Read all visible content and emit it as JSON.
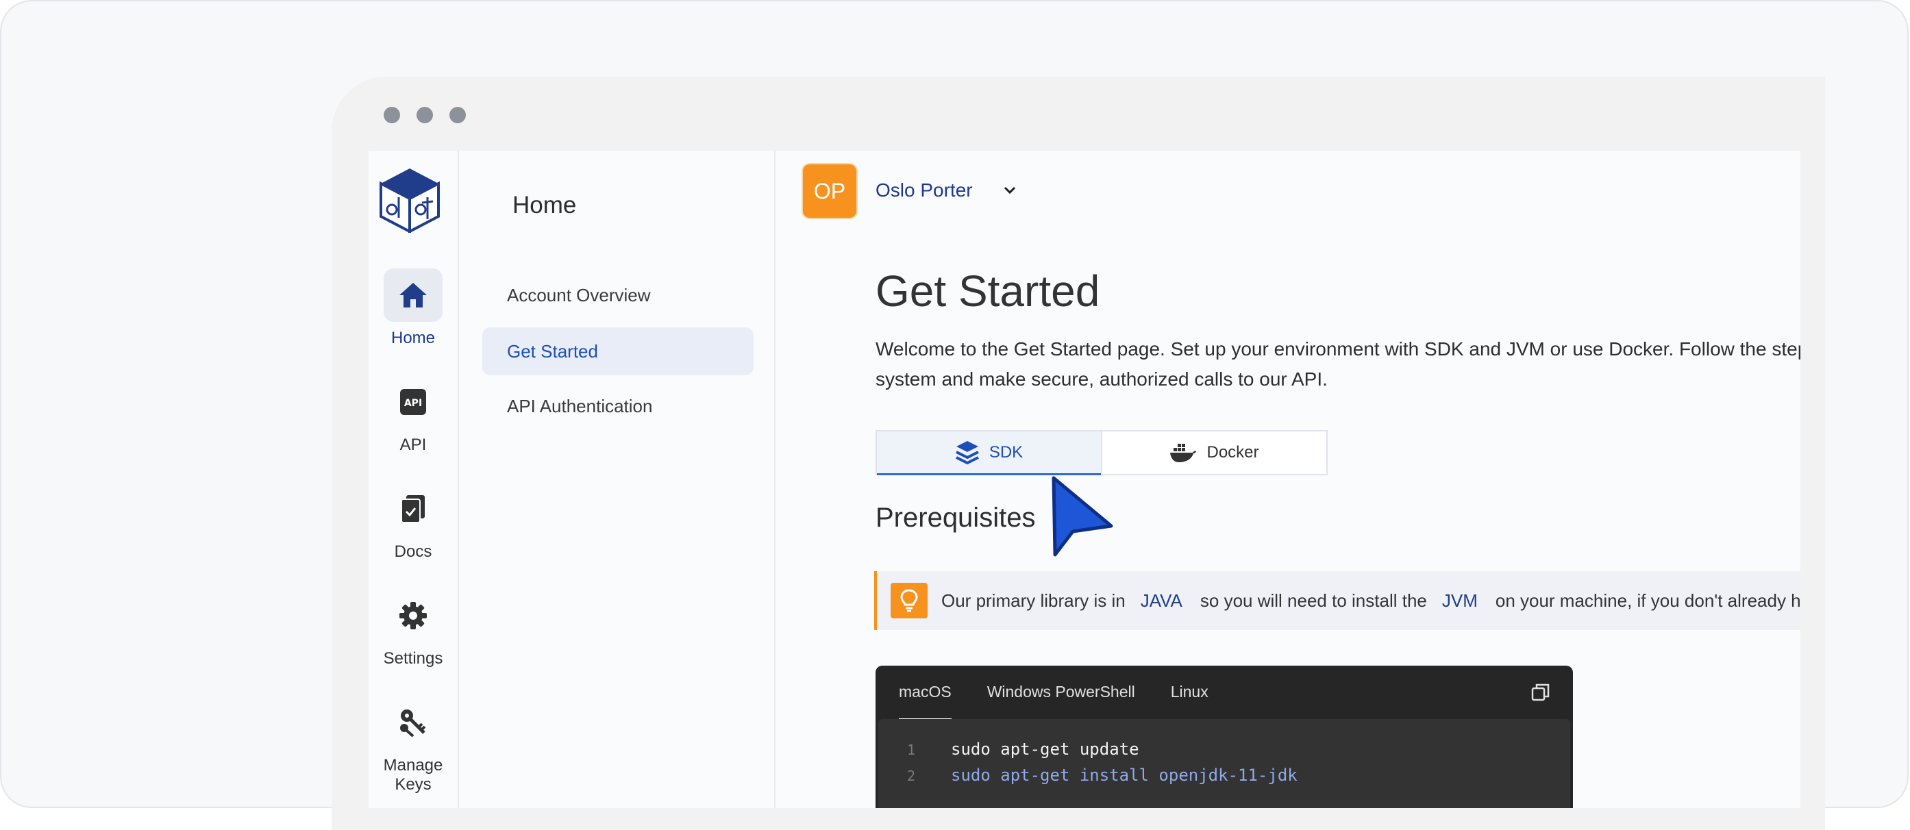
{
  "rail": {
    "items": [
      {
        "label": "Home",
        "icon": "home-icon",
        "active": true
      },
      {
        "label": "API",
        "icon": "api-icon",
        "active": false
      },
      {
        "label": "Docs",
        "icon": "docs-icon",
        "active": false
      },
      {
        "label": "Settings",
        "icon": "gear-icon",
        "active": false
      },
      {
        "label": "Manage Keys",
        "icon": "keys-icon",
        "active": false
      }
    ]
  },
  "subnav": {
    "title": "Home",
    "items": [
      {
        "label": "Account Overview",
        "active": false
      },
      {
        "label": "Get Started",
        "active": true
      },
      {
        "label": "API Authentication",
        "active": false
      }
    ]
  },
  "user": {
    "initials": "OP",
    "name": "Oslo Porter"
  },
  "page": {
    "title": "Get Started",
    "intro": "Welcome to the Get Started page. Set up your environment with SDK and JVM or use Docker. Follow the steps to prepare your system and make secure, authorized calls to our API."
  },
  "tabs": [
    {
      "label": "SDK",
      "icon": "layers-icon",
      "active": true
    },
    {
      "label": "Docker",
      "icon": "docker-icon",
      "active": false
    }
  ],
  "prerequisites": {
    "title": "Prerequisites",
    "callout": {
      "part1": "Our primary library is in",
      "chip1": "JAVA",
      "part2": "so you will need to install the",
      "chip2": "JVM",
      "part3": "on your machine, if you don't already have it."
    }
  },
  "code": {
    "tabs": [
      {
        "label": "macOS",
        "active": true
      },
      {
        "label": "Windows PowerShell",
        "active": false
      },
      {
        "label": "Linux",
        "active": false
      }
    ],
    "lines": [
      {
        "num": "1",
        "text": "sudo apt-get update"
      },
      {
        "num": "2",
        "text": "sudo apt-get install openjdk-11-jdk"
      }
    ]
  },
  "colors": {
    "accent": "#1f4fb5",
    "brand_orange": "#f7921e",
    "navy": "#1d3a8a"
  }
}
